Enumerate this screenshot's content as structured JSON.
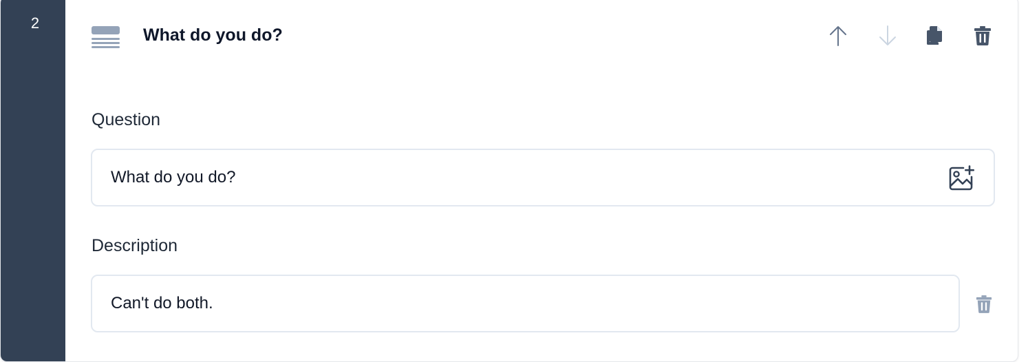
{
  "question_block": {
    "number": "2",
    "title": "What do you do?",
    "type_icon": "lines-icon",
    "actions": [
      "arrow-up-icon",
      "arrow-down-icon",
      "copy-icon",
      "trash-icon"
    ]
  },
  "question_field": {
    "label": "Question",
    "value": "What do you do?",
    "icon": "image-add-icon"
  },
  "description_field": {
    "label": "Description",
    "value": "Can't do both.",
    "icon": "trash-icon"
  },
  "colors": {
    "rail": "#334155",
    "border": "#e2e8f0",
    "icon_dark": "#475569",
    "icon_light": "#94a3b8"
  }
}
